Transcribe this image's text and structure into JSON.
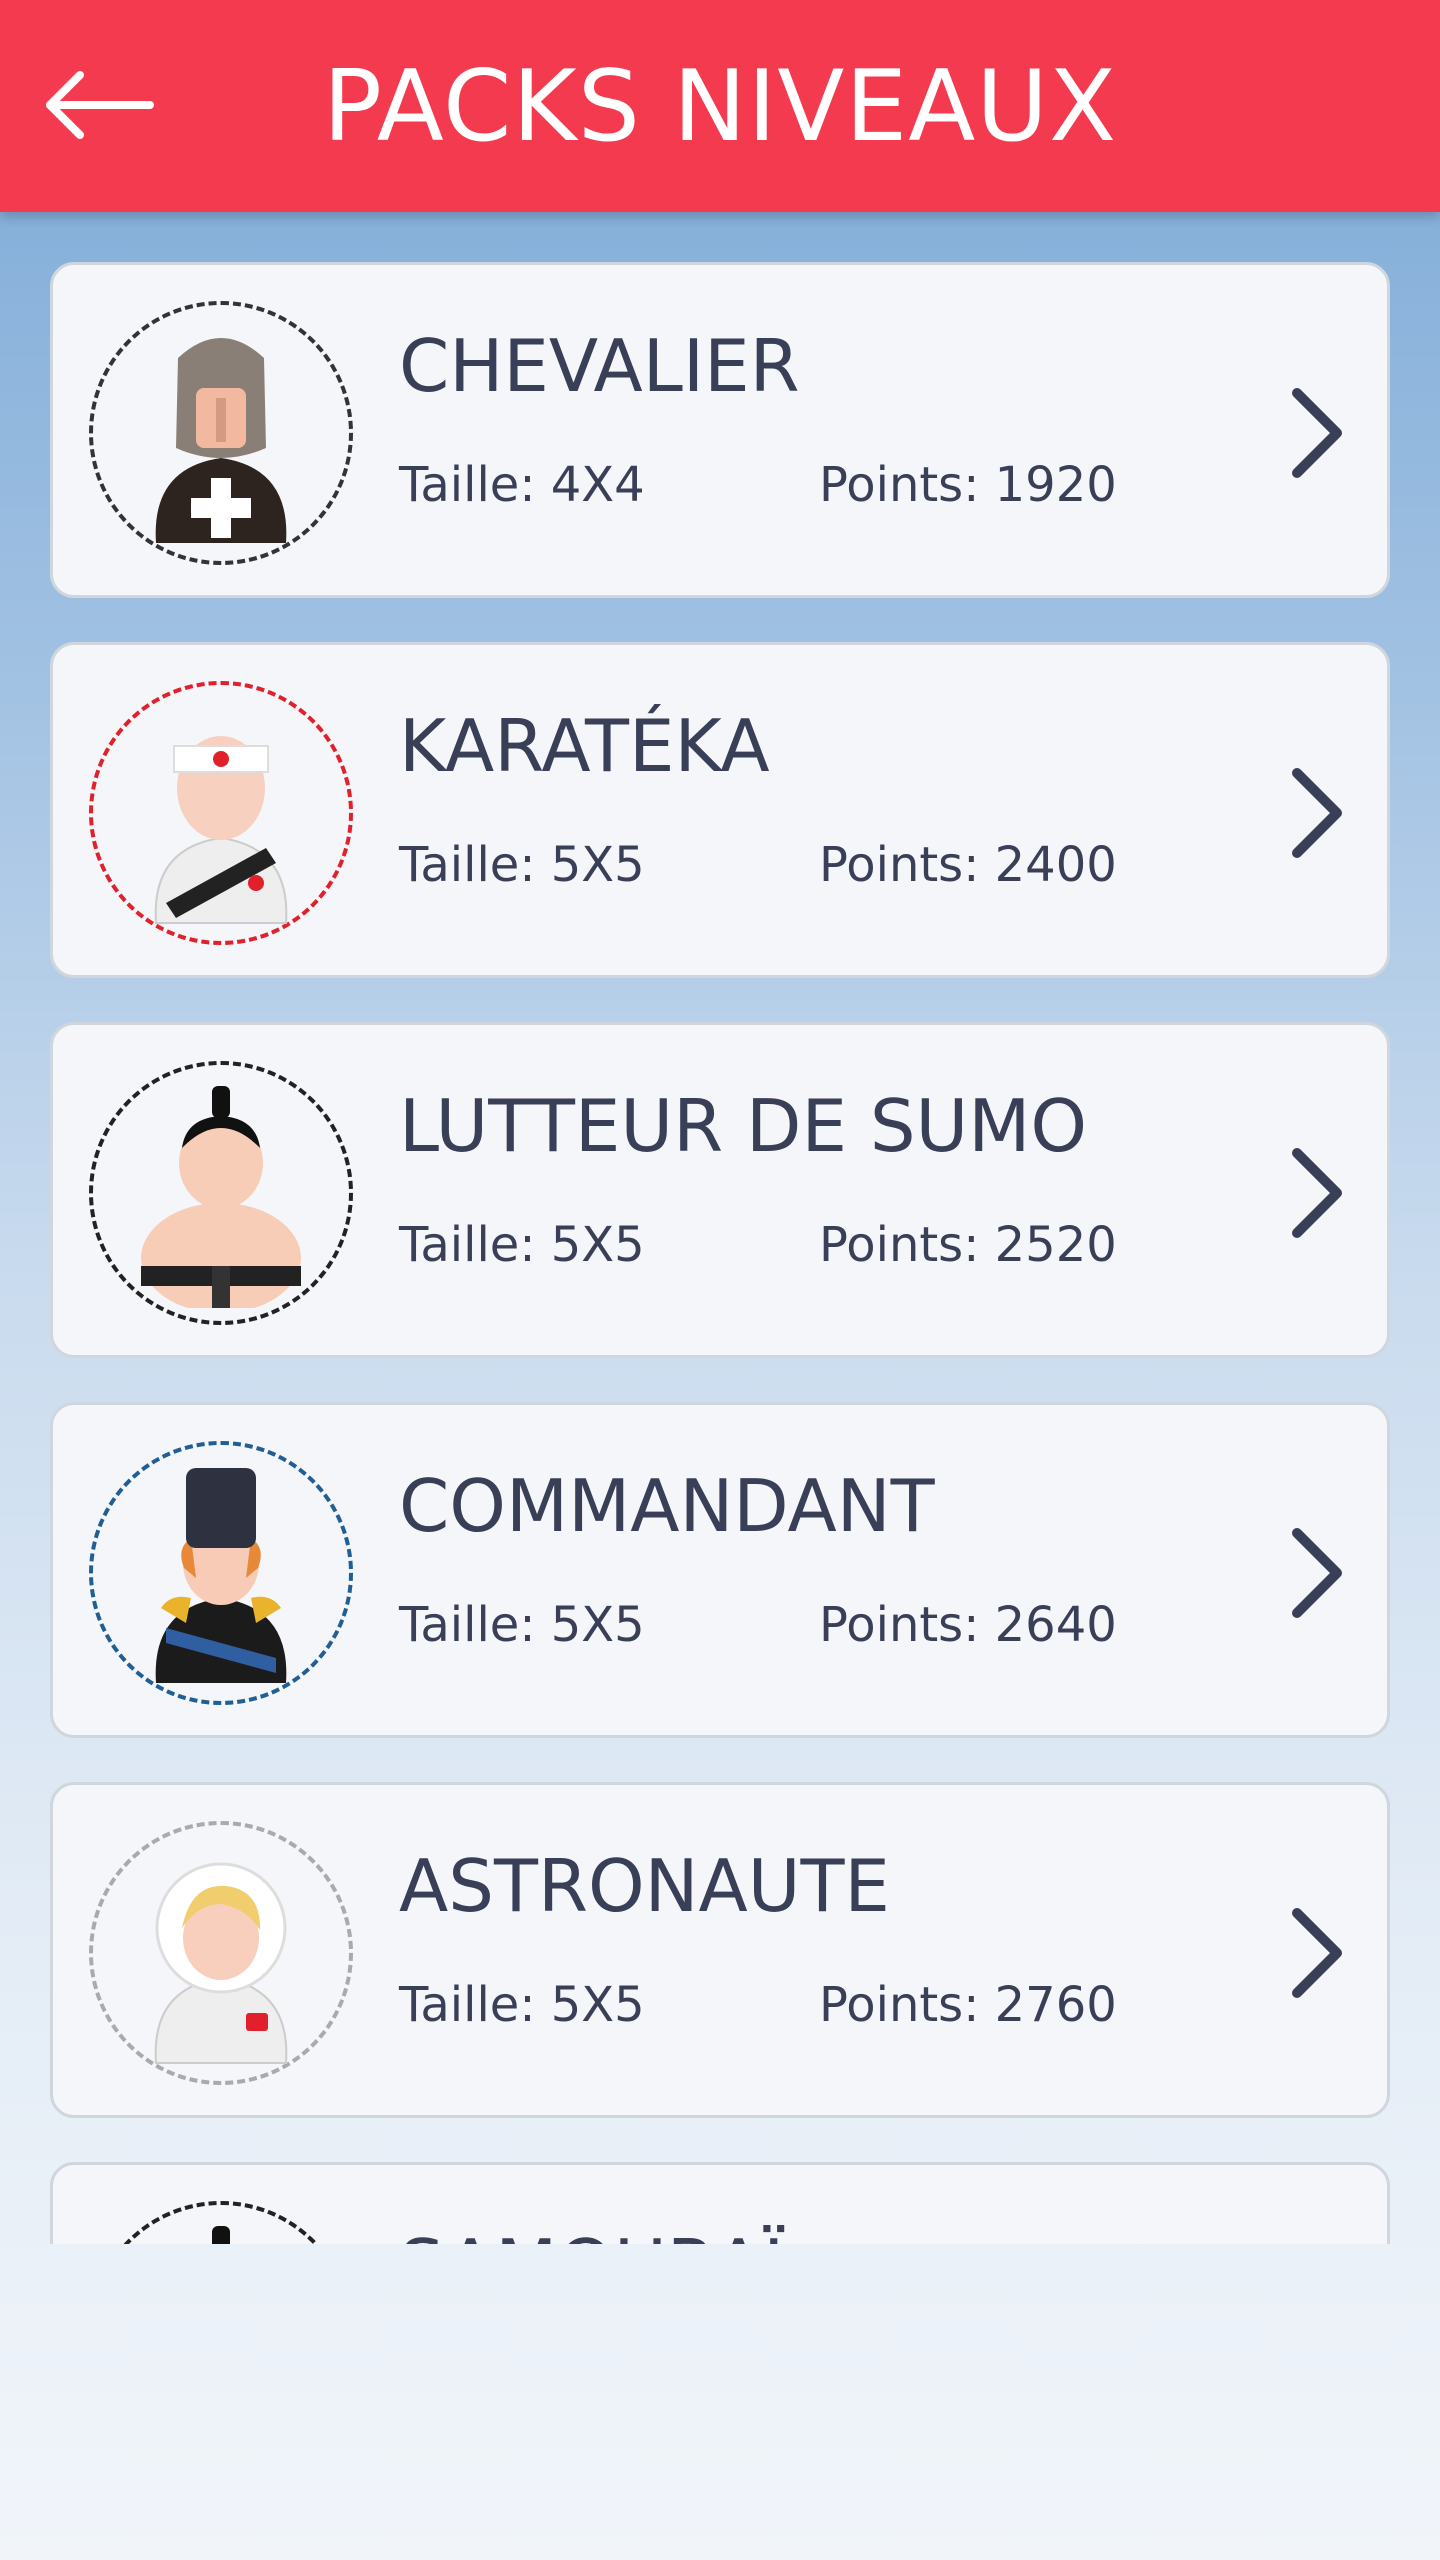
{
  "header": {
    "title": "PACKS NIVEAUX",
    "back_icon": "arrow-left-icon",
    "color": "#f43a4f"
  },
  "packs": [
    {
      "name": "CHEVALIER",
      "size": "Taille: 4X4",
      "points": "Points: 1920",
      "ring_color": "#333333",
      "icon": "knight-avatar-icon"
    },
    {
      "name": "KARATÉKA",
      "size": "Taille: 5X5",
      "points": "Points: 2400",
      "ring_color": "#e0212b",
      "icon": "karateka-avatar-icon"
    },
    {
      "name": "LUTTEUR DE SUMO",
      "size": "Taille: 5X5",
      "points": "Points: 2520",
      "ring_color": "#222222",
      "icon": "sumo-avatar-icon"
    },
    {
      "name": "COMMANDANT",
      "size": "Taille: 5X5",
      "points": "Points: 2640",
      "ring_color": "#1f5f95",
      "icon": "commander-avatar-icon"
    },
    {
      "name": "ASTRONAUTE",
      "size": "Taille: 5X5",
      "points": "Points: 2760",
      "ring_color": "#aaaaaa",
      "icon": "astronaut-avatar-icon"
    },
    {
      "name": "SAMOURAÏ",
      "size": "",
      "points": "",
      "ring_color": "#222222",
      "icon": "samurai-avatar-icon"
    }
  ],
  "text_color": "#3a3f58"
}
